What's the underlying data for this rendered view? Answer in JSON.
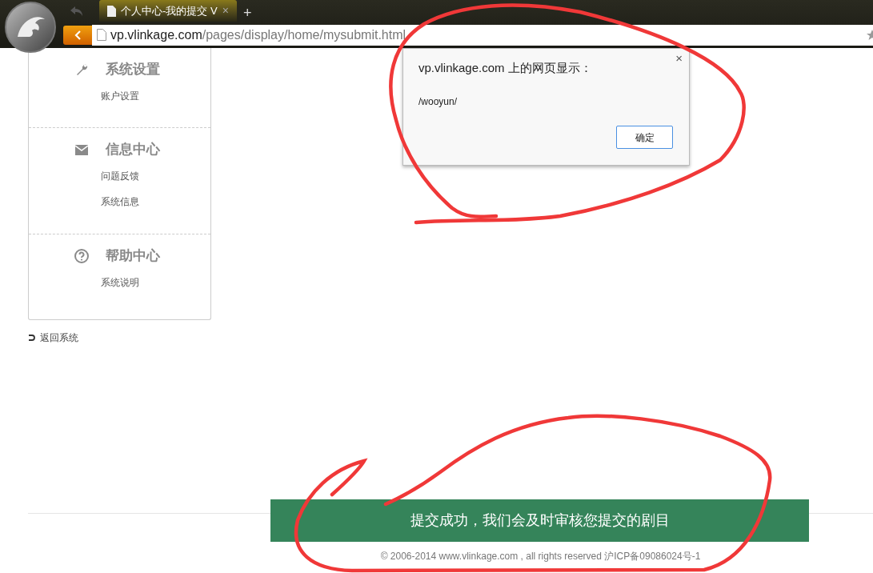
{
  "browser": {
    "tab_title": "个人中心-我的提交 V",
    "url_host": "vp.vlinkage.com",
    "url_path": "/pages/display/home/mysubmit.html",
    "new_tab": "+",
    "close_tab": "×"
  },
  "sidebar": {
    "sections": [
      {
        "kind": "wrench",
        "title": "系统设置",
        "items": [
          "账户设置"
        ]
      },
      {
        "kind": "mail",
        "title": "信息中心",
        "items": [
          "问题反馈",
          "系统信息"
        ]
      },
      {
        "kind": "help",
        "title": "帮助中心",
        "items": [
          "系统说明"
        ]
      }
    ]
  },
  "back_link": "返回系统",
  "dialog": {
    "title": "vp.vlinkage.com 上的网页显示：",
    "message": "/wooyun/",
    "button": "确定",
    "close": "×"
  },
  "toast": "提交成功，我们会及时审核您提交的剧目",
  "copyright": "© 2006-2014 www.vlinkage.com , all rights reserved 沪ICP备09086024号-1"
}
